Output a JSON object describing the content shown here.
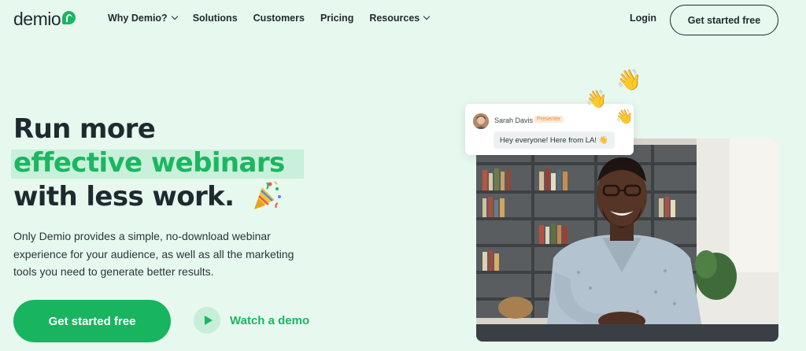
{
  "nav": {
    "logo": "demio",
    "items": [
      {
        "label": "Why Demio?",
        "has_dropdown": true
      },
      {
        "label": "Solutions",
        "has_dropdown": false
      },
      {
        "label": "Customers",
        "has_dropdown": false
      },
      {
        "label": "Pricing",
        "has_dropdown": false
      },
      {
        "label": "Resources",
        "has_dropdown": true
      }
    ],
    "login": "Login",
    "cta": "Get started free"
  },
  "hero": {
    "headline_line1": "Run more",
    "headline_highlight": "effective webinars",
    "headline_line3": "with less work.",
    "subtext_lines": [
      "Only Demio provides a simple, no-download webinar",
      "experience for your audience, as well as all the marketing",
      "tools you need to generate better results."
    ],
    "cta_primary": "Get started free",
    "cta_secondary": "Watch a demo"
  },
  "chat": {
    "name": "Sarah Davis",
    "badge": "Presenter",
    "message": "Hey everyone! Here from LA! 👋"
  },
  "colors": {
    "background": "#e7f8ef",
    "brand_green": "#1bb661",
    "highlight": "#c9f0da",
    "text_dark": "#1f2a2e"
  },
  "icons": [
    "confetti-icon",
    "play-icon",
    "chevron-down-icon",
    "waving-hand-icon"
  ]
}
